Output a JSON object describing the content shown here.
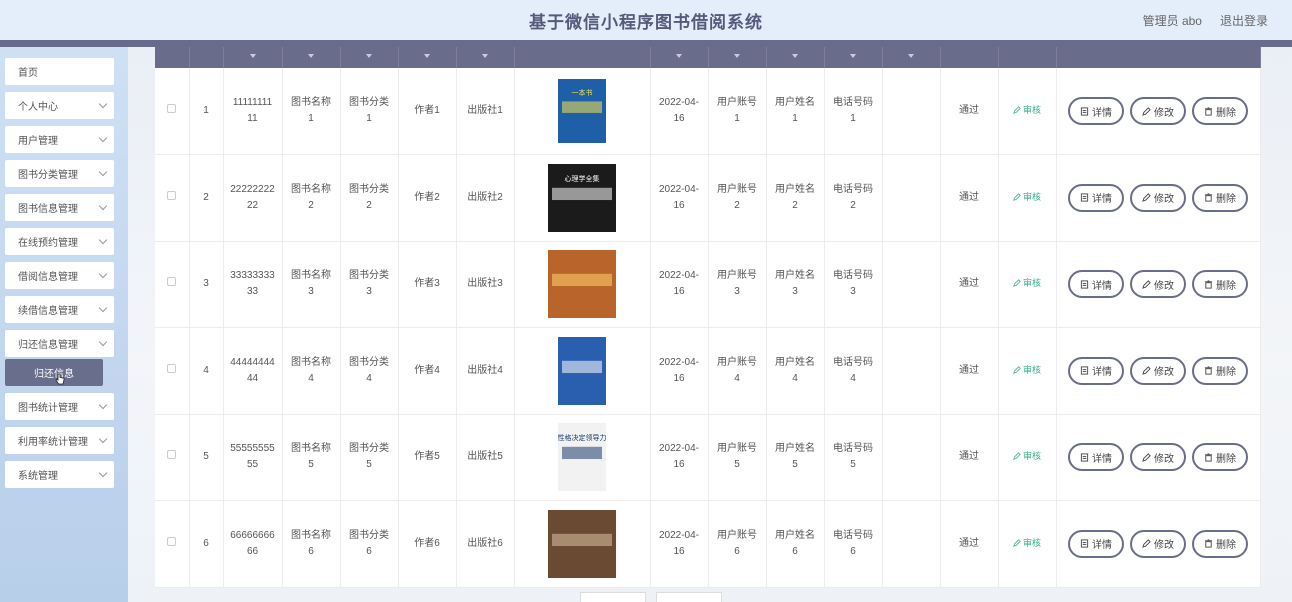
{
  "header": {
    "title": "基于微信小程序图书借阅系统",
    "admin": "管理员 abo",
    "logout": "退出登录"
  },
  "sidebar": {
    "items": [
      {
        "label": "首页",
        "has_arrow": false
      },
      {
        "label": "个人中心",
        "has_arrow": true
      },
      {
        "label": "用户管理",
        "has_arrow": true
      },
      {
        "label": "图书分类管理",
        "has_arrow": true
      },
      {
        "label": "图书信息管理",
        "has_arrow": true
      },
      {
        "label": "在线预约管理",
        "has_arrow": true
      },
      {
        "label": "借阅信息管理",
        "has_arrow": true
      },
      {
        "label": "续借信息管理",
        "has_arrow": true
      },
      {
        "label": "归还信息管理",
        "has_arrow": true
      }
    ],
    "active_sub": "归还信息",
    "items_after": [
      {
        "label": "图书统计管理"
      },
      {
        "label": "利用率统计管理"
      },
      {
        "label": "系统管理"
      }
    ]
  },
  "table": {
    "status_action": "审核",
    "btn_detail": "详情",
    "btn_edit": "修改",
    "btn_delete": "删除",
    "rows": [
      {
        "index": "1",
        "code": "11111111 11",
        "name": "图书名称 1",
        "category": "图书分类 1",
        "author": "作者1",
        "publisher": "出版社1",
        "date": "2022-04- 16",
        "account": "用户账号 1",
        "username": "用户姓名 1",
        "phone": "电话号码 1",
        "status": "通过"
      },
      {
        "index": "2",
        "code": "22222222 22",
        "name": "图书名称 2",
        "category": "图书分类 2",
        "author": "作者2",
        "publisher": "出版社2",
        "date": "2022-04- 16",
        "account": "用户账号 2",
        "username": "用户姓名 2",
        "phone": "电话号码 2",
        "status": "通过"
      },
      {
        "index": "3",
        "code": "33333333 33",
        "name": "图书名称 3",
        "category": "图书分类 3",
        "author": "作者3",
        "publisher": "出版社3",
        "date": "2022-04- 16",
        "account": "用户账号 3",
        "username": "用户姓名 3",
        "phone": "电话号码 3",
        "status": "通过"
      },
      {
        "index": "4",
        "code": "44444444 44",
        "name": "图书名称 4",
        "category": "图书分类 4",
        "author": "作者4",
        "publisher": "出版社4",
        "date": "2022-04- 16",
        "account": "用户账号 4",
        "username": "用户姓名 4",
        "phone": "电话号码 4",
        "status": "通过"
      },
      {
        "index": "5",
        "code": "55555555 55",
        "name": "图书名称 5",
        "category": "图书分类 5",
        "author": "作者5",
        "publisher": "出版社5",
        "date": "2022-04- 16",
        "account": "用户账号 5",
        "username": "用户姓名 5",
        "phone": "电话号码 5",
        "status": "通过"
      },
      {
        "index": "6",
        "code": "66666666 66",
        "name": "图书名称 6",
        "category": "图书分类 6",
        "author": "作者6",
        "publisher": "出版社6",
        "date": "2022-04- 16",
        "account": "用户账号 6",
        "username": "用户姓名 6",
        "phone": "电话号码 6",
        "status": "通过"
      }
    ]
  },
  "covers": [
    {
      "title": "一本书",
      "bg": "#1f5fa8",
      "fg": "#f7e34a"
    },
    {
      "title": "心理学全集",
      "bg": "#1b1b1b",
      "fg": "#ffffff"
    },
    {
      "title": "",
      "bg": "#b8642a",
      "fg": "#ffd36b"
    },
    {
      "title": "",
      "bg": "#2a5fb0",
      "fg": "#ffffff"
    },
    {
      "title": "性格决定领导力",
      "bg": "#f2f2f2",
      "fg": "#1a3a6a"
    },
    {
      "title": "",
      "bg": "#6b4a34",
      "fg": "#d8c3a0"
    }
  ],
  "colors": {
    "accent": "#6a6c8b",
    "header_bg": "#e4eefb",
    "audit_green": "#3bb08a"
  }
}
